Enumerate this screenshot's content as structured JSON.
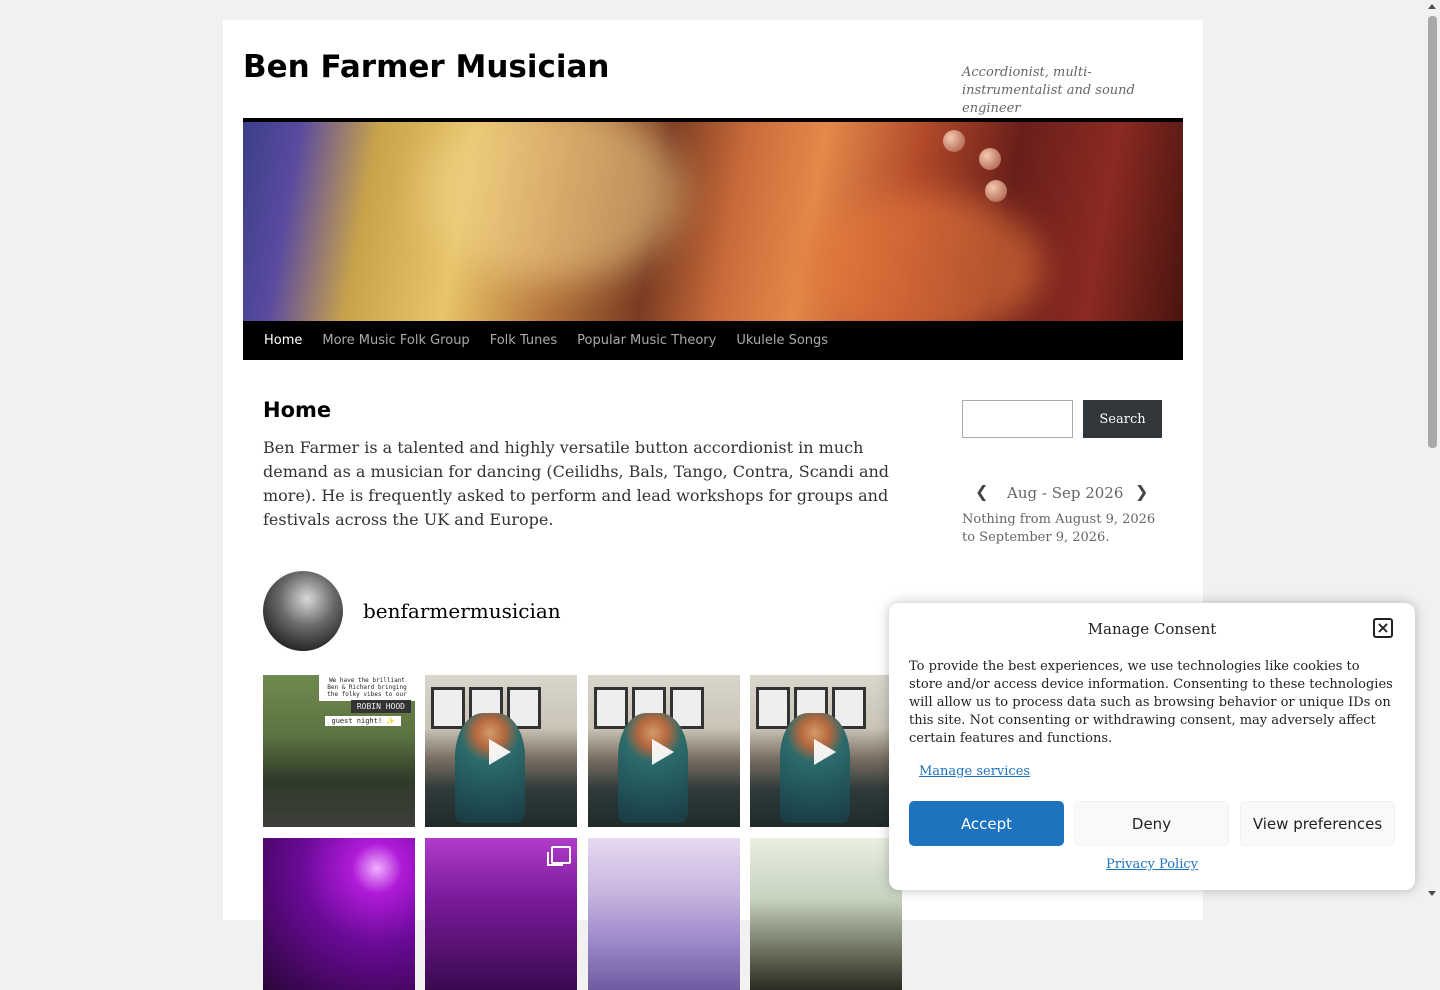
{
  "site": {
    "title": "Ben Farmer Musician",
    "description": "Accordionist, multi-instrumentalist and sound engineer"
  },
  "nav": {
    "items": [
      {
        "label": "Home",
        "active": true
      },
      {
        "label": "More Music Folk Group",
        "active": false
      },
      {
        "label": "Folk Tunes",
        "active": false
      },
      {
        "label": "Popular Music Theory",
        "active": false
      },
      {
        "label": "Ukulele Songs",
        "active": false
      }
    ]
  },
  "main": {
    "title": "Home",
    "intro": "Ben Farmer is a talented and highly versatile button accordionist in much demand as a musician for dancing (Ceilidhs, Bals, Tango, Contra, Scandi and more). He is frequently asked to perform and lead workshops for groups and festivals across the UK and Europe."
  },
  "instagram": {
    "username": "benfarmermusician",
    "tile1_lines": [
      "We have the brilliant",
      "Ben & Richard bringing",
      "the folky vibes to our"
    ],
    "tile1_banner": "ROBIN HOOD",
    "tile1_footer": "guest night! ✨"
  },
  "sidebar": {
    "search_button": "Search",
    "calendar_range": "Aug - Sep 2026",
    "calendar_note": "Nothing from August 9, 2026 to September 9, 2026."
  },
  "consent": {
    "title": "Manage Consent",
    "text": "To provide the best experiences, we use technologies like cookies to store and/or access device information. Consenting to these technologies will allow us to process data such as browsing behavior or unique IDs on this site. Not consenting or withdrawing consent, may adversely affect certain features and functions.",
    "manage_services": "Manage services",
    "accept": "Accept",
    "deny": "Deny",
    "view_preferences": "View preferences",
    "privacy_policy": "Privacy Policy",
    "close_icon": "close-icon"
  },
  "colors": {
    "accent": "#1e73be",
    "nav_bg": "#000000",
    "search_button_bg": "#32373c",
    "page_bg": "#f1f1f1"
  }
}
